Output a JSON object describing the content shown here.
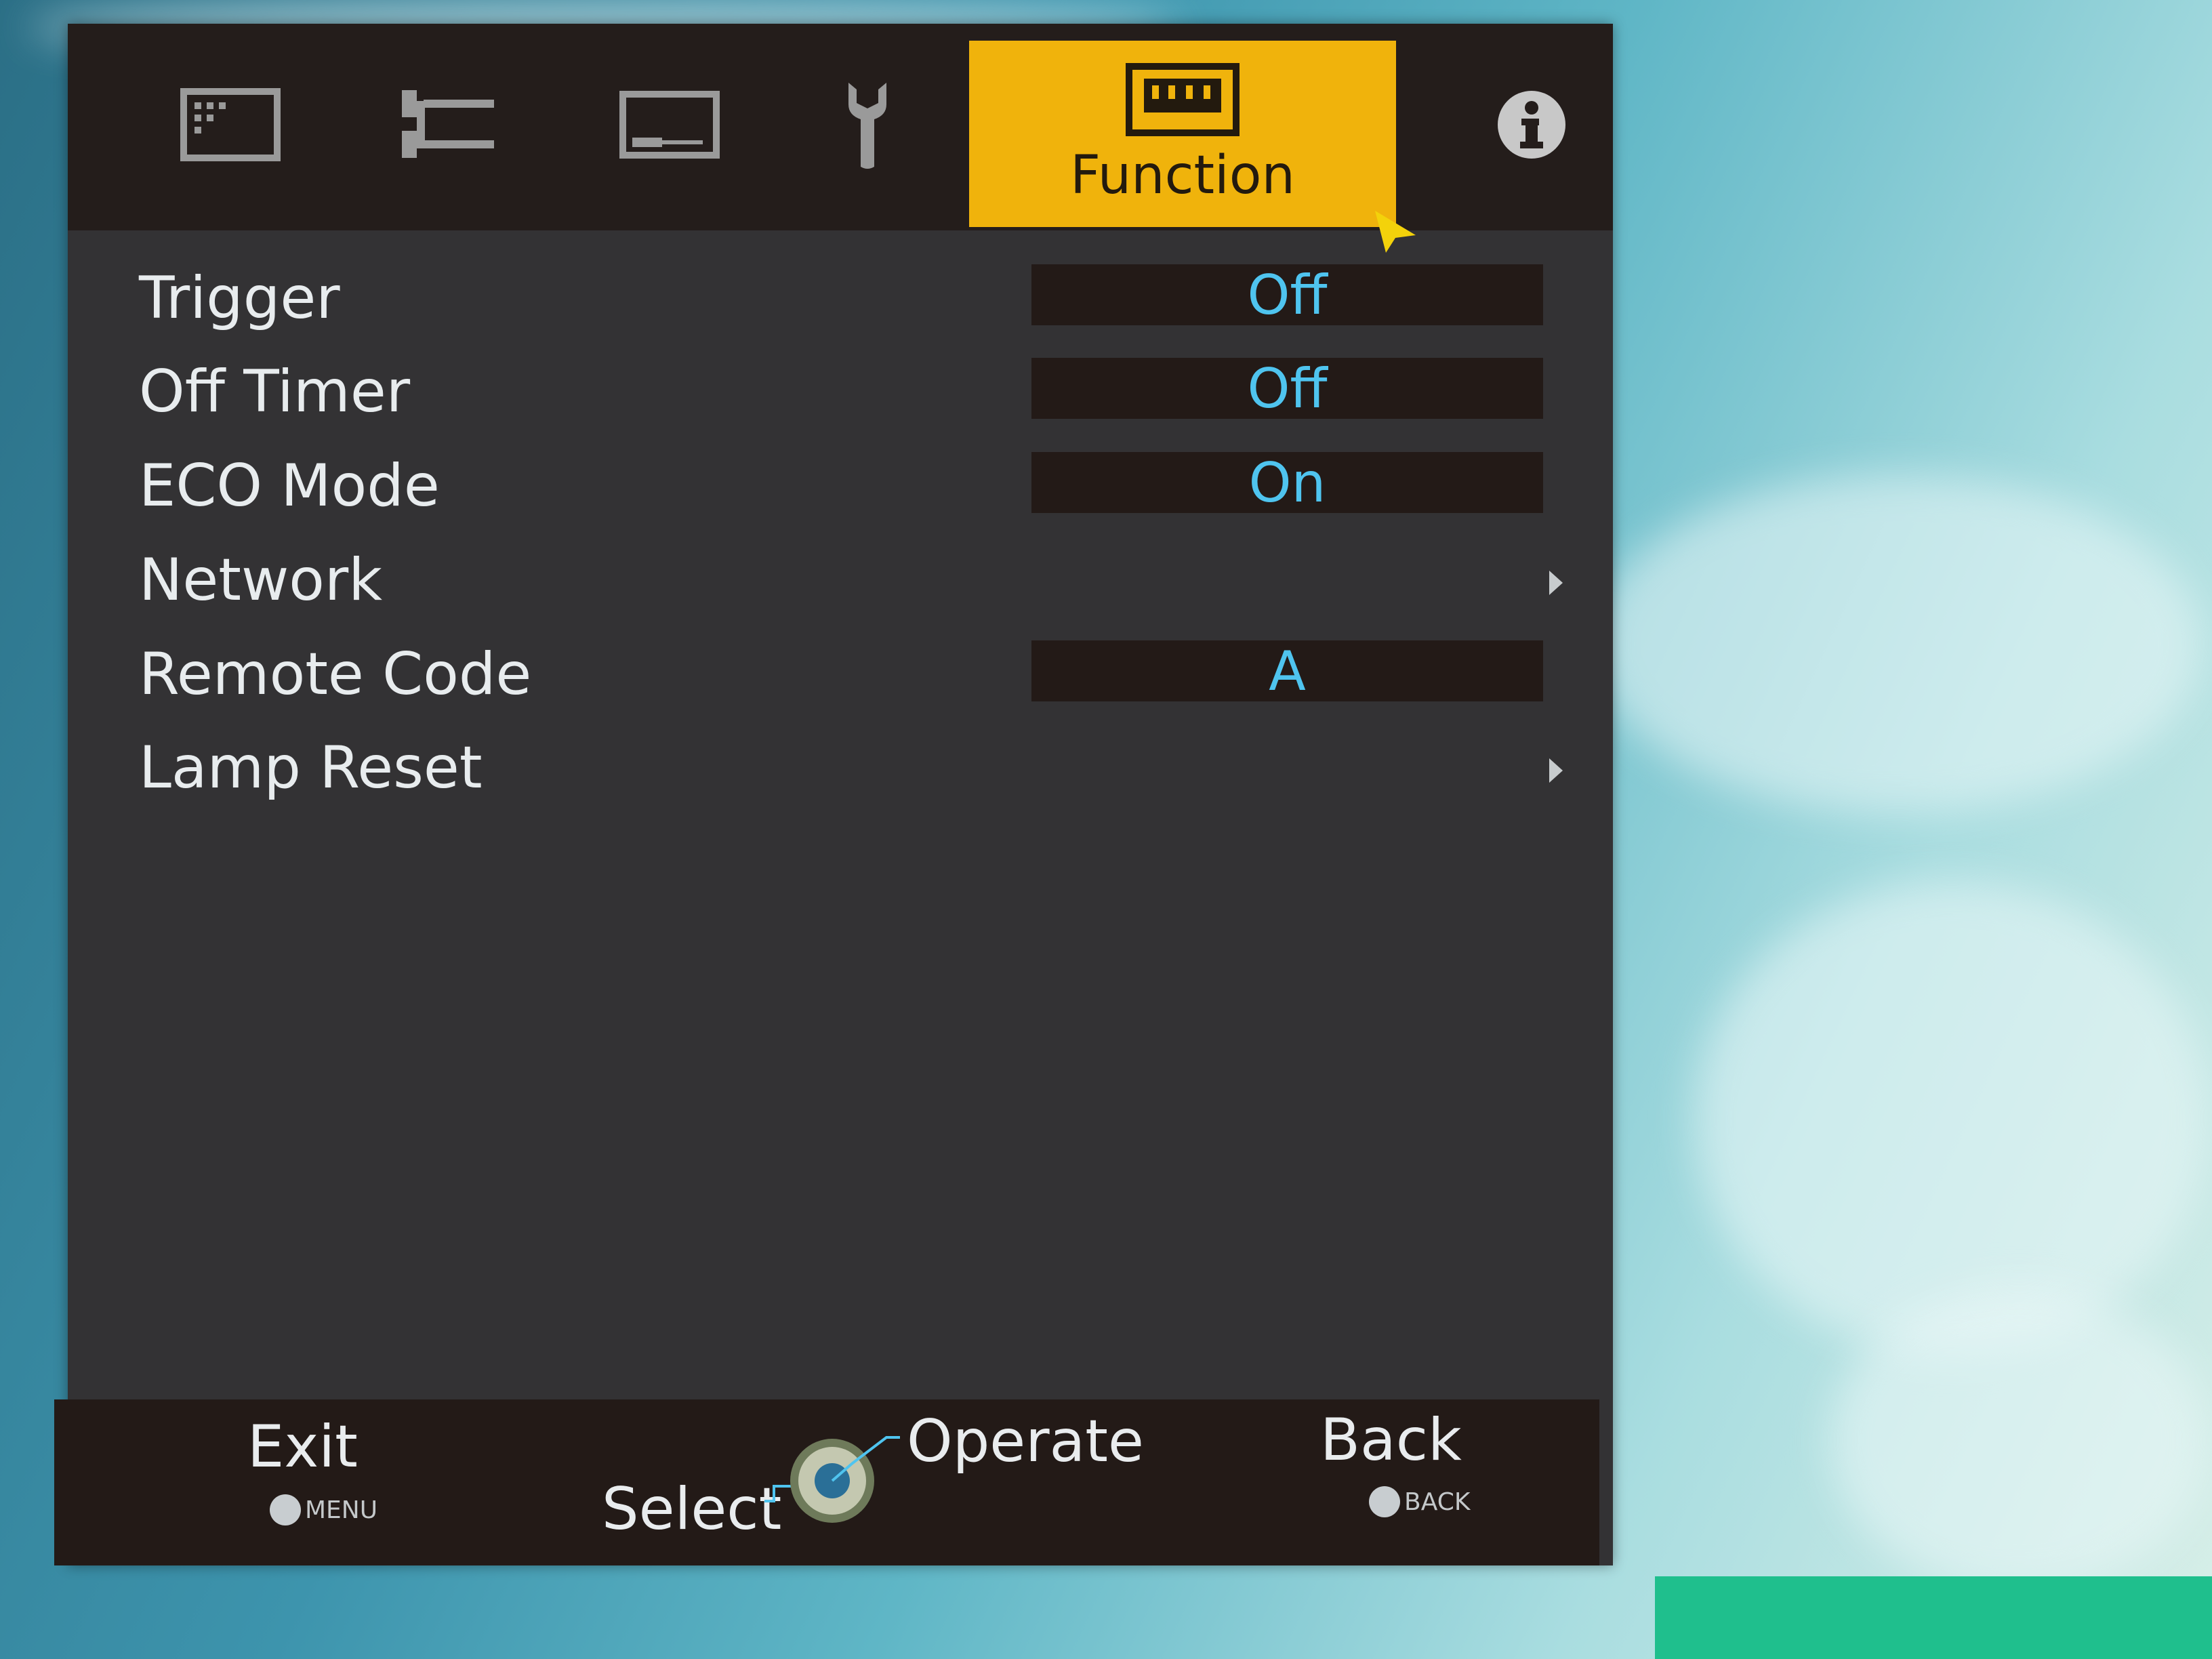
{
  "tabs": [
    {
      "icon": "picture-icon",
      "label": ""
    },
    {
      "icon": "input-settings-icon",
      "label": ""
    },
    {
      "icon": "screen-icon",
      "label": ""
    },
    {
      "icon": "wrench-icon",
      "label": ""
    },
    {
      "icon": "function-icon",
      "label": "Function",
      "active": true
    },
    {
      "icon": "info-icon",
      "label": ""
    }
  ],
  "colors": {
    "accent": "#f0b30c",
    "value_text": "#4fc4ef",
    "panel": "#333234",
    "bar": "#241d1b"
  },
  "menu": {
    "items": [
      {
        "label": "Trigger",
        "value": "Off"
      },
      {
        "label": "Off Timer",
        "value": "Off"
      },
      {
        "label": "ECO Mode",
        "value": "On"
      },
      {
        "label": "Network",
        "value": "",
        "submenu": true
      },
      {
        "label": "Remote Code",
        "value": "A"
      },
      {
        "label": "Lamp Reset",
        "value": "",
        "submenu": true
      }
    ]
  },
  "footer": {
    "exit_label": "Exit",
    "exit_key": "MENU",
    "select_label": "Select",
    "operate_label": "Operate",
    "back_label": "Back",
    "back_key": "BACK"
  }
}
